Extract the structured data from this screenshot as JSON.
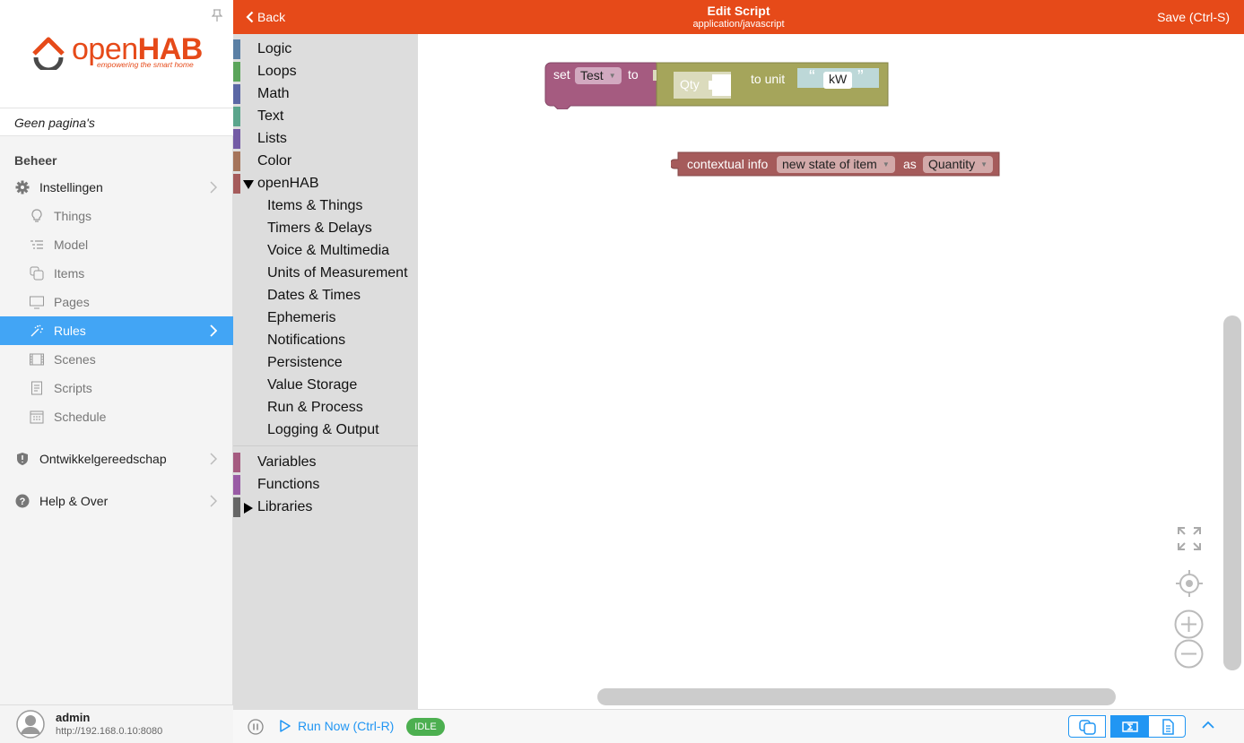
{
  "sidebar": {
    "logo_text_light": "open",
    "logo_text_bold": "HAB",
    "logo_tagline": "empowering the smart home",
    "no_pages": "Geen pagina's",
    "section_title": "Beheer",
    "settings_label": "Instellingen",
    "sub_items": [
      {
        "label": "Things",
        "icon": "lightbulb-icon"
      },
      {
        "label": "Model",
        "icon": "list-icon"
      },
      {
        "label": "Items",
        "icon": "items-icon"
      },
      {
        "label": "Pages",
        "icon": "monitor-icon"
      },
      {
        "label": "Rules",
        "icon": "magic-wand-icon",
        "active": true
      },
      {
        "label": "Scenes",
        "icon": "film-icon"
      },
      {
        "label": "Scripts",
        "icon": "document-icon"
      },
      {
        "label": "Schedule",
        "icon": "calendar-icon"
      }
    ],
    "developer_tools": "Ontwikkelgereedschap",
    "help_about": "Help & Over",
    "user": {
      "name": "admin",
      "url": "http://192.168.0.10:8080"
    }
  },
  "header": {
    "back_label": "Back",
    "title": "Edit Script",
    "subtitle": "application/javascript",
    "save_label": "Save (Ctrl-S)",
    "color": "#e64a19"
  },
  "toolbox": {
    "categories": [
      {
        "label": "Logic",
        "color": "#5b80a5"
      },
      {
        "label": "Loops",
        "color": "#5ba55b"
      },
      {
        "label": "Math",
        "color": "#5b67a5"
      },
      {
        "label": "Text",
        "color": "#5ba58c"
      },
      {
        "label": "Lists",
        "color": "#745ba5"
      },
      {
        "label": "Color",
        "color": "#a5745b"
      },
      {
        "label": "openHAB",
        "color": "#a55b5b",
        "expanded": true
      }
    ],
    "openhab_subcategories": [
      "Items & Things",
      "Timers & Delays",
      "Voice & Multimedia",
      "Units of Measurement",
      "Dates & Times",
      "Ephemeris",
      "Notifications",
      "Persistence",
      "Value Storage",
      "Run & Process",
      "Logging & Output"
    ],
    "bottom_categories": [
      {
        "label": "Variables",
        "color": "#a55b80"
      },
      {
        "label": "Functions",
        "color": "#995ba5"
      },
      {
        "label": "Libraries",
        "color": "#666666",
        "collapsed": true
      }
    ]
  },
  "workspace": {
    "set_block": {
      "set_label": "set",
      "variable": "Test",
      "to_label": "to",
      "qty_label": "Qty",
      "to_unit_label": "to unit",
      "open_quote": "“",
      "unit_value": "kW",
      "close_quote": "”",
      "colors": {
        "variable": "#a55b80",
        "uom": "#a5a55b"
      }
    },
    "context_block": {
      "label": "contextual info",
      "selection": "new state of item",
      "as_label": "as",
      "type": "Quantity",
      "color": "#a55b5b"
    }
  },
  "bottom_bar": {
    "run_label": "Run Now (Ctrl-R)",
    "status": "IDLE",
    "accent": "#2196f3"
  }
}
